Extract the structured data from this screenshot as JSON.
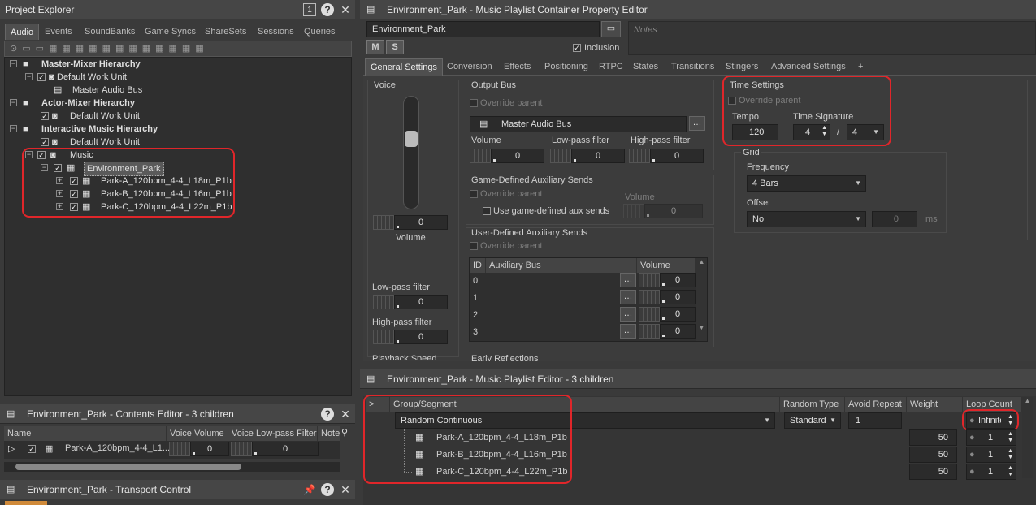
{
  "project_explorer": {
    "title": "Project Explorer",
    "tabs": [
      "Audio",
      "Events",
      "SoundBanks",
      "Game Syncs",
      "ShareSets",
      "Sessions",
      "Queries"
    ],
    "tree": [
      {
        "label": "Master-Mixer Hierarchy"
      },
      {
        "label": "Default Work Unit"
      },
      {
        "label": "Master Audio Bus"
      },
      {
        "label": "Actor-Mixer Hierarchy"
      },
      {
        "label": "Default Work Unit"
      },
      {
        "label": "Interactive Music Hierarchy"
      },
      {
        "label": "Default Work Unit"
      },
      {
        "label": "Music"
      },
      {
        "label": "Environment_Park"
      },
      {
        "label": "Park-A_120bpm_4-4_L18m_P1b"
      },
      {
        "label": "Park-B_120bpm_4-4_L16m_P1b"
      },
      {
        "label": "Park-C_120bpm_4-4_L22m_P1b"
      }
    ]
  },
  "contents_editor": {
    "title": "Environment_Park - Contents Editor - 3 children",
    "columns": [
      "Name",
      "Voice Volume",
      "Voice Low-pass Filter",
      "Notes"
    ],
    "row": {
      "name": "Park-A_120bpm_4-4_L1...",
      "volume": "0",
      "lpf": "0"
    }
  },
  "transport": {
    "title": "Environment_Park - Transport Control"
  },
  "property_editor": {
    "title": "Environment_Park - Music Playlist Container Property Editor",
    "name": "Environment_Park",
    "notes_placeholder": "Notes",
    "m_label": "M",
    "s_label": "S",
    "inclusion_label": "Inclusion",
    "tabs": [
      "General Settings",
      "Conversion",
      "Effects",
      "Positioning",
      "RTPC",
      "States",
      "Transitions",
      "Stingers",
      "Advanced Settings",
      "+"
    ],
    "voice": {
      "label": "Voice",
      "volume_value": "0",
      "volume_label": "Volume",
      "lpf_label": "Low-pass filter",
      "lpf_value": "0",
      "hpf_label": "High-pass filter",
      "hpf_value": "0",
      "playback_label": "Playback Speed"
    },
    "output_bus": {
      "label": "Output Bus",
      "override": "Override parent",
      "bus": "Master Audio Bus",
      "volume_label": "Volume",
      "volume": "0",
      "lpf_label": "Low-pass filter",
      "lpf": "0",
      "hpf_label": "High-pass filter",
      "hpf": "0"
    },
    "game_aux": {
      "label": "Game-Defined Auxiliary Sends",
      "override": "Override parent",
      "use_label": "Use game-defined aux sends",
      "volume_label": "Volume",
      "volume": "0"
    },
    "user_aux": {
      "label": "User-Defined Auxiliary Sends",
      "override": "Override parent",
      "col_id": "ID",
      "col_bus": "Auxiliary Bus",
      "col_volume": "Volume",
      "rows": [
        {
          "id": "0",
          "vol": "0"
        },
        {
          "id": "1",
          "vol": "0"
        },
        {
          "id": "2",
          "vol": "0"
        },
        {
          "id": "3",
          "vol": "0"
        }
      ]
    },
    "early_reflections": "Early Reflections",
    "time": {
      "label": "Time Settings",
      "override": "Override parent",
      "tempo_label": "Tempo",
      "tempo": "120",
      "sig_label": "Time Signature",
      "sig_top": "4",
      "slash": "/",
      "sig_bottom": "4"
    },
    "grid": {
      "label": "Grid",
      "freq_label": "Frequency",
      "freq": "4 Bars",
      "offset_label": "Offset",
      "offset": "No",
      "offset_value": "0",
      "ms": "ms"
    }
  },
  "playlist_editor": {
    "title": "Environment_Park - Music Playlist Editor - 3 children",
    "expander": ">",
    "columns": [
      "Group/Segment",
      "Random Type",
      "Avoid Repeat",
      "Weight",
      "Loop Count"
    ],
    "group": {
      "label": "Random Continuous",
      "random_type": "Standard",
      "avoid_repeat": "1",
      "loop": "Infinite"
    },
    "segments": [
      {
        "label": "Park-A_120bpm_4-4_L18m_P1b",
        "weight": "50",
        "loop": "1"
      },
      {
        "label": "Park-B_120bpm_4-4_L16m_P1b",
        "weight": "50",
        "loop": "1"
      },
      {
        "label": "Park-C_120bpm_4-4_L22m_P1b",
        "weight": "50",
        "loop": "1"
      }
    ]
  },
  "colors": {
    "highlight": "#e0262a",
    "panel": "#3a3a3a",
    "title_bar": "#464646"
  }
}
